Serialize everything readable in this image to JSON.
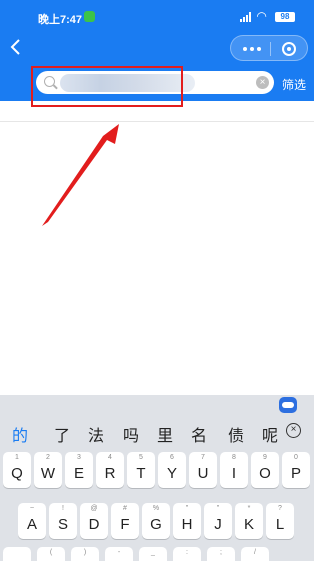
{
  "status_bar": {
    "time": "晚上7:47",
    "battery": "98"
  },
  "toolbar": {
    "filter_label": "筛选"
  },
  "search": {
    "clear_glyph": "×"
  },
  "keyboard": {
    "candidates": [
      "的",
      "了",
      "法",
      "吗",
      "里",
      "名",
      "债",
      "呢"
    ],
    "delete_glyph": "×",
    "row1": [
      {
        "key": "Q",
        "alt": "1"
      },
      {
        "key": "W",
        "alt": "2"
      },
      {
        "key": "E",
        "alt": "3"
      },
      {
        "key": "R",
        "alt": "4"
      },
      {
        "key": "T",
        "alt": "5"
      },
      {
        "key": "Y",
        "alt": "6"
      },
      {
        "key": "U",
        "alt": "7"
      },
      {
        "key": "I",
        "alt": "8"
      },
      {
        "key": "O",
        "alt": "9"
      },
      {
        "key": "P",
        "alt": "0"
      }
    ],
    "row2": [
      {
        "key": "A",
        "alt": "~"
      },
      {
        "key": "S",
        "alt": "!"
      },
      {
        "key": "D",
        "alt": "@"
      },
      {
        "key": "F",
        "alt": "#"
      },
      {
        "key": "G",
        "alt": "%"
      },
      {
        "key": "H",
        "alt": "\""
      },
      {
        "key": "J",
        "alt": "\""
      },
      {
        "key": "K",
        "alt": "*"
      },
      {
        "key": "L",
        "alt": "?"
      }
    ],
    "row3": [
      {
        "key": "",
        "alt": ""
      },
      {
        "key": "",
        "alt": "("
      },
      {
        "key": "",
        "alt": ")"
      },
      {
        "key": "",
        "alt": "-"
      },
      {
        "key": "",
        "alt": "_"
      },
      {
        "key": "",
        "alt": ":"
      },
      {
        "key": "",
        "alt": ";"
      },
      {
        "key": "",
        "alt": "/"
      }
    ]
  },
  "colors": {
    "brand_blue": "#1a7cf2",
    "annotation_red": "#e21d1d"
  }
}
